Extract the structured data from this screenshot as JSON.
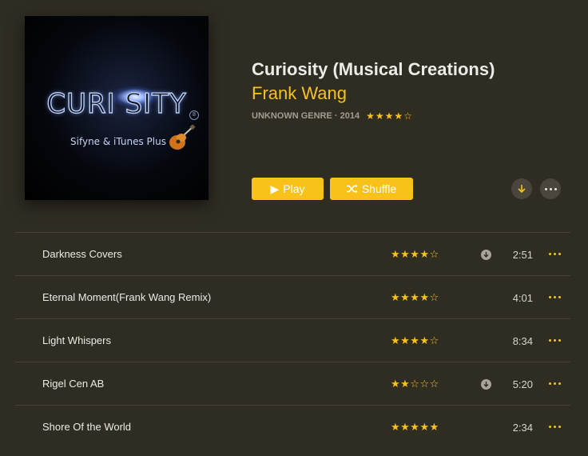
{
  "album": {
    "artwork": {
      "title_text": "CURI  SITY",
      "badge": "8",
      "subtitle": "Sifyne & iTunes Plus"
    },
    "title": "Curiosity (Musical Creations)",
    "artist": "Frank Wang",
    "meta": "UNKNOWN GENRE · 2014",
    "rating_stars": "★★★★☆",
    "rating": 4
  },
  "actions": {
    "play_icon": "▶",
    "play_label": "Play",
    "shuffle_label": "Shuffle",
    "download_icon": "download-icon",
    "more_icon": "more-icon"
  },
  "colors": {
    "accent": "#f8c21a",
    "background": "#2f2c22",
    "divider": "#46423a"
  },
  "tracks": [
    {
      "title": "Darkness Covers",
      "stars": "★★★★☆",
      "rating": 4,
      "downloadable": true,
      "time": "2:51"
    },
    {
      "title": "Eternal Moment(Frank Wang Remix)",
      "stars": "★★★★☆",
      "rating": 4,
      "downloadable": false,
      "time": "4:01"
    },
    {
      "title": "Light Whispers",
      "stars": "★★★★☆",
      "rating": 4,
      "downloadable": false,
      "time": "8:34"
    },
    {
      "title": "Rigel Cen AB",
      "stars": "★★☆☆☆",
      "rating": 2,
      "downloadable": true,
      "time": "5:20"
    },
    {
      "title": "Shore Of the World",
      "stars": "★★★★★",
      "rating": 5,
      "downloadable": false,
      "time": "2:34"
    }
  ]
}
